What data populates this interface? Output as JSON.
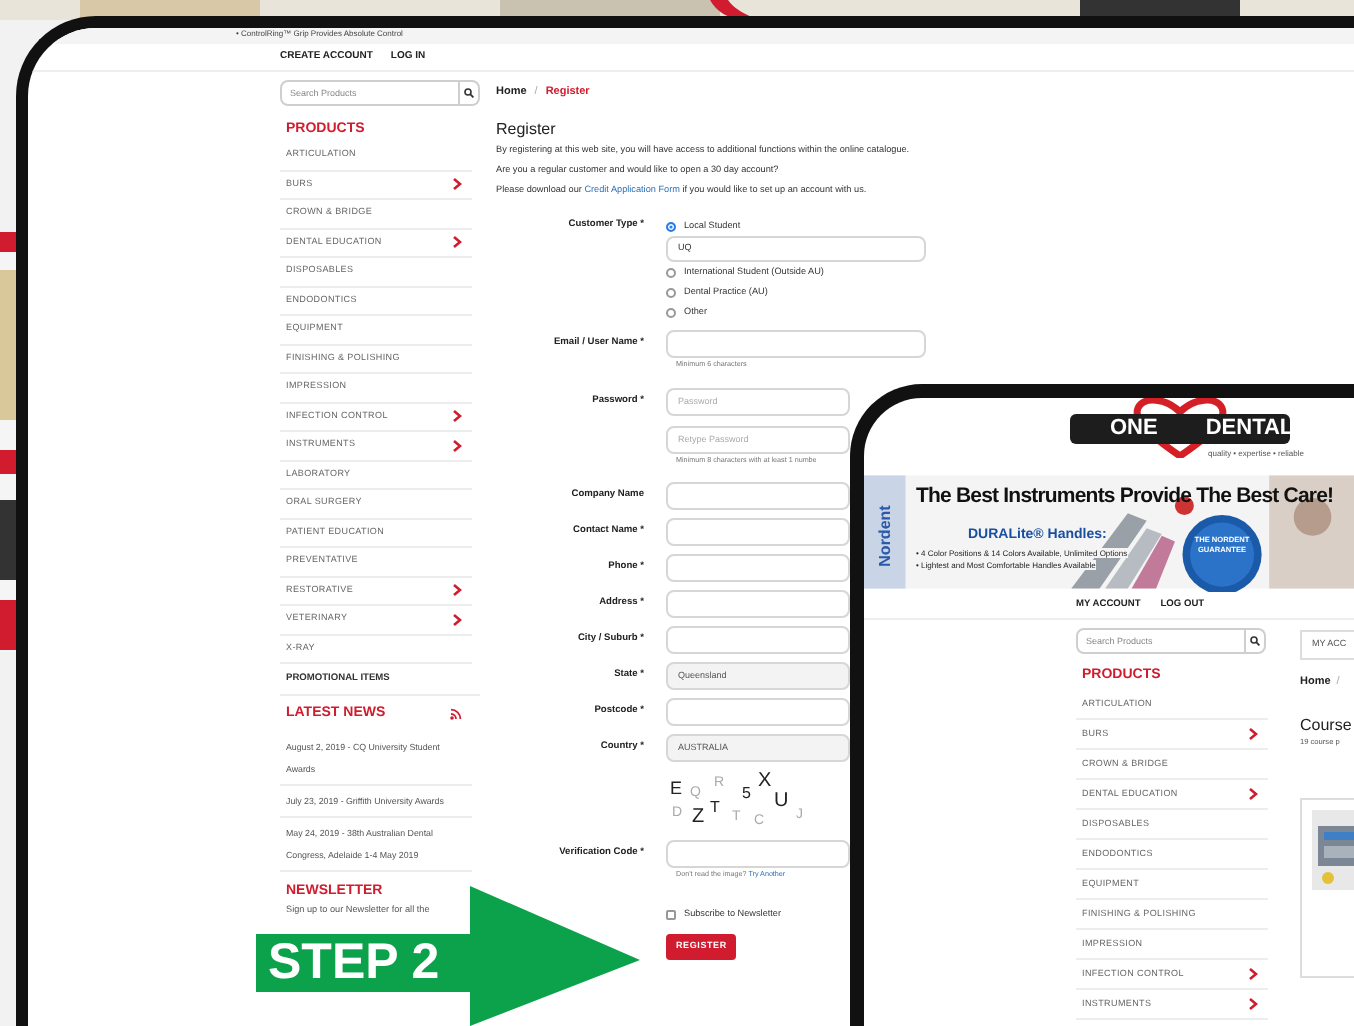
{
  "back_device": {
    "banner_caption": "• ControlRing™ Grip Provides Absolute Control",
    "nav": [
      "CREATE ACCOUNT",
      "LOG IN"
    ],
    "search": {
      "placeholder": "Search Products"
    },
    "products_heading": "PRODUCTS",
    "products": [
      {
        "label": "ARTICULATION",
        "has_submenu": false
      },
      {
        "label": "BURS",
        "has_submenu": true
      },
      {
        "label": "CROWN & BRIDGE",
        "has_submenu": false
      },
      {
        "label": "DENTAL EDUCATION",
        "has_submenu": true
      },
      {
        "label": "DISPOSABLES",
        "has_submenu": false
      },
      {
        "label": "ENDODONTICS",
        "has_submenu": false
      },
      {
        "label": "EQUIPMENT",
        "has_submenu": false
      },
      {
        "label": "FINISHING & POLISHING",
        "has_submenu": false
      },
      {
        "label": "IMPRESSION",
        "has_submenu": false
      },
      {
        "label": "INFECTION CONTROL",
        "has_submenu": true
      },
      {
        "label": "INSTRUMENTS",
        "has_submenu": true
      },
      {
        "label": "LABORATORY",
        "has_submenu": false
      },
      {
        "label": "ORAL SURGERY",
        "has_submenu": false
      },
      {
        "label": "PATIENT EDUCATION",
        "has_submenu": false
      },
      {
        "label": "PREVENTATIVE",
        "has_submenu": false
      },
      {
        "label": "RESTORATIVE",
        "has_submenu": true
      },
      {
        "label": "VETERINARY",
        "has_submenu": true
      },
      {
        "label": "X-RAY",
        "has_submenu": false
      }
    ],
    "promotional": "PROMOTIONAL ITEMS",
    "news_heading": "LATEST NEWS",
    "news": [
      "August 2, 2019 - CQ University Student Awards",
      "July 23, 2019 - Griffith University Awards",
      "May 24, 2019 - 38th Australian Dental Congress, Adelaide 1-4 May 2019"
    ],
    "newsletter_heading": "NEWSLETTER",
    "newsletter_text": "Sign up to our Newsletter for all the",
    "breadcrumb": [
      {
        "label": "Home",
        "selected": false
      },
      {
        "label": "Register",
        "selected": true
      }
    ],
    "breadcrumb_separator": "/",
    "title": "Register",
    "intro": [
      "By registering at this web site, you will have access to additional functions within the online catalogue.",
      "Are you a regular customer and would like to open a 30 day account?"
    ],
    "download": {
      "before": "Please download our",
      "link": "Credit Application Form",
      "after": "if you would like to set up an account with us."
    },
    "fields": [
      {
        "kind": "radio",
        "label": "Customer Type *",
        "options": [
          {
            "label": "Local Student",
            "selected": true
          },
          {
            "label": "International Student (Outside AU)",
            "selected": false
          },
          {
            "label": "Dental Practice (AU)",
            "selected": false
          },
          {
            "label": "Other",
            "selected": false
          }
        ],
        "value": "UQ"
      },
      {
        "kind": "text",
        "label": "Email / User Name *",
        "hint": "Minimum 6 characters"
      },
      {
        "kind": "password",
        "label": "Password *",
        "placeholder": "Password",
        "placeholder_retype": "Retype Password",
        "hint": "Minimum 8 characters with at least 1 numbe"
      },
      {
        "kind": "text",
        "label": "Company Name"
      },
      {
        "kind": "text",
        "label": "Contact Name *"
      },
      {
        "kind": "text",
        "label": "Phone *"
      },
      {
        "kind": "text",
        "label": "Address *"
      },
      {
        "kind": "text",
        "label": "City / Suburb *"
      },
      {
        "kind": "select",
        "label": "State *",
        "value": "Queensland"
      },
      {
        "kind": "text",
        "label": "Postcode *"
      },
      {
        "kind": "select",
        "label": "Country *",
        "value": "AUSTRALIA"
      },
      {
        "kind": "captcha",
        "characters": [
          "E",
          "Q",
          "R",
          "5",
          "X",
          "U",
          "D",
          "Z",
          "T",
          "T",
          "C",
          "J"
        ]
      },
      {
        "kind": "text",
        "label": "Verification Code *",
        "hint": "Don't read the image?",
        "hint_link": "Try Another"
      },
      {
        "kind": "checkbox",
        "label": "Subscribe to Newsletter",
        "checked": false
      },
      {
        "kind": "button",
        "label": "REGISTER"
      }
    ]
  },
  "front_device": {
    "logo": {
      "word_1": "ONE",
      "word_2": "DENTAL",
      "tagline": "quality • expertise • reliable"
    },
    "banner": {
      "brand": "Nordent",
      "headline": "The Best Instruments Provide The Best Care!",
      "product": "DURALite® Handles:",
      "bullets": [
        "• 4 Color Positions & 14 Colors Available, Unlimited Options",
        "• Lightest and Most Comfortable Handles Available"
      ],
      "badge": "THE NORDENT GUARANTEE"
    },
    "nav": [
      "MY ACCOUNT",
      "LOG OUT"
    ],
    "search": {
      "placeholder": "Search Products"
    },
    "products_heading": "PRODUCTS",
    "products": [
      {
        "label": "ARTICULATION",
        "has_submenu": false
      },
      {
        "label": "BURS",
        "has_submenu": true
      },
      {
        "label": "CROWN & BRIDGE",
        "has_submenu": false
      },
      {
        "label": "DENTAL EDUCATION",
        "has_submenu": true
      },
      {
        "label": "DISPOSABLES",
        "has_submenu": false
      },
      {
        "label": "ENDODONTICS",
        "has_submenu": false
      },
      {
        "label": "EQUIPMENT",
        "has_submenu": false
      },
      {
        "label": "FINISHING & POLISHING",
        "has_submenu": false
      },
      {
        "label": "IMPRESSION",
        "has_submenu": false
      },
      {
        "label": "INFECTION CONTROL",
        "has_submenu": true
      },
      {
        "label": "INSTRUMENTS",
        "has_submenu": true
      }
    ],
    "tab": "MY ACC",
    "breadcrumb": {
      "label": "Home",
      "separator": "/"
    },
    "title": "Course",
    "subtitle": "19 course p"
  },
  "step_label": "STEP 2"
}
